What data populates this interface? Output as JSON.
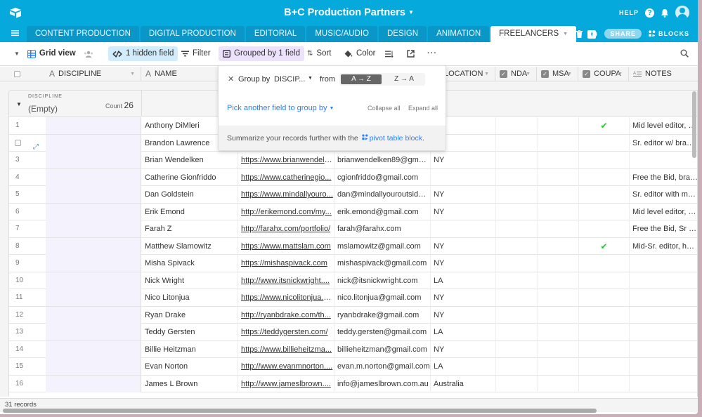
{
  "app": {
    "base_title": "B+C Production Partners",
    "help_label": "HELP",
    "share_label": "SHARE",
    "blocks_label": "BLOCKS"
  },
  "tabs": [
    {
      "label": "CONTENT PRODUCTION",
      "active": false
    },
    {
      "label": "DIGITAL PRODUCTION",
      "active": false
    },
    {
      "label": "EDITORIAL",
      "active": false
    },
    {
      "label": "MUSIC/AUDIO",
      "active": false
    },
    {
      "label": "DESIGN",
      "active": false
    },
    {
      "label": "ANIMATION",
      "active": false
    },
    {
      "label": "FREELANCERS",
      "active": true
    }
  ],
  "viewbar": {
    "view_name": "Grid view",
    "hidden_fields": "1 hidden field",
    "filter": "Filter",
    "grouped": "Grouped by 1 field",
    "sort": "Sort",
    "color": "Color"
  },
  "columns": {
    "discipline": "DISCIPLINE",
    "name": "NAME",
    "location": "LOCATION",
    "nda": "NDA",
    "msa": "MSA",
    "coupa": "COUPA",
    "notes": "NOTES"
  },
  "group": {
    "field_label": "DISCIPLINE",
    "value": "(Empty)",
    "count_label": "Count",
    "count": "26"
  },
  "popover": {
    "group_by_label": "Group by",
    "field": "DISCIP...",
    "from_label": "from",
    "asc": "A → Z",
    "desc": "Z → A",
    "pick_another": "Pick another field to group by",
    "collapse_all": "Collapse all",
    "expand_all": "Expand all",
    "footer_text": "Summarize your records further with the",
    "footer_link": "pivot table block",
    "footer_end": "."
  },
  "rows": [
    {
      "num": "1",
      "name": "Anthony DiMleri",
      "website": "",
      "email": "",
      "location": "",
      "coupa": true,
      "notes": "Mid level editor, com"
    },
    {
      "num": "",
      "name": "Brandon Lawrence",
      "website": "",
      "email": "",
      "location": "",
      "coupa": false,
      "notes": "Sr. editor w/ branded"
    },
    {
      "num": "3",
      "name": "Brian Wendelken",
      "website": "https://www.brianwendelk...",
      "email": "brianwendelken89@gmail...",
      "location": "NY",
      "coupa": false,
      "notes": ""
    },
    {
      "num": "4",
      "name": "Catherine Gionfriddo",
      "website": "https://www.catherinegio...",
      "email": "cgionfriddo@gmail.com",
      "location": "",
      "coupa": false,
      "notes": "Free the Bid, brande"
    },
    {
      "num": "5",
      "name": "Dan Goldstein",
      "website": "https://www.mindallyouro...",
      "email": "dan@mindallyouroutsides...",
      "location": "NY",
      "coupa": false,
      "notes": "Sr. editor with motio"
    },
    {
      "num": "6",
      "name": "Erik Emond",
      "website": "http://erikemond.com/my...",
      "email": "erik.emond@gmail.com",
      "location": "NY",
      "coupa": false,
      "notes": "Mid level editor, basi"
    },
    {
      "num": "7",
      "name": "Farah Z",
      "website": "http://farahx.com/portfolio/",
      "email": "farah@farahx.com",
      "location": "",
      "coupa": false,
      "notes": "Free the Bid, Sr edito"
    },
    {
      "num": "8",
      "name": "Matthew Slamowitz",
      "website": "https://www.mattslam.com",
      "email": "mslamowitz@gmail.com",
      "location": "NY",
      "coupa": true,
      "notes": "Mid-Sr. editor, has w"
    },
    {
      "num": "9",
      "name": "Misha Spivack",
      "website": "https://mishaspivack.com",
      "email": "mishaspivack@gmail.com",
      "location": "NY",
      "coupa": false,
      "notes": ""
    },
    {
      "num": "10",
      "name": "Nick Wright",
      "website": "http://www.itsnickwright....",
      "email": "nick@itsnickwright.com",
      "location": "LA",
      "coupa": false,
      "notes": ""
    },
    {
      "num": "11",
      "name": "Nico Litonjua",
      "website": "https://www.nicolitonjua.c...",
      "email": "nico.litonjua@gmail.com",
      "location": "NY",
      "coupa": false,
      "notes": ""
    },
    {
      "num": "12",
      "name": "Ryan Drake",
      "website": "http://ryanbdrake.com/th...",
      "email": "ryanbdrake@gmail.com",
      "location": "NY",
      "coupa": false,
      "notes": ""
    },
    {
      "num": "13",
      "name": "Teddy Gersten",
      "website": "https://teddygersten.com/",
      "email": "teddy.gersten@gmail.com",
      "location": "LA",
      "coupa": false,
      "notes": ""
    },
    {
      "num": "14",
      "name": "Billie Heitzman",
      "website": "https://www.billieheitzma...",
      "email": "billieheitzman@gmail.com",
      "location": "NY",
      "coupa": false,
      "notes": ""
    },
    {
      "num": "15",
      "name": "Evan Norton",
      "website": "http://www.evanmnorton....",
      "email": "evan.m.norton@gmail.com",
      "location": "LA",
      "coupa": false,
      "notes": ""
    },
    {
      "num": "16",
      "name": "James L Brown",
      "website": "http://www.jameslbrown....",
      "email": "info@jameslbrown.com.au",
      "location": "Australia",
      "coupa": false,
      "notes": ""
    }
  ],
  "footer": {
    "records": "31 records"
  },
  "colors": {
    "brand": "#05a9dc",
    "accent": "#2d7ff9",
    "check": "#20c933"
  }
}
